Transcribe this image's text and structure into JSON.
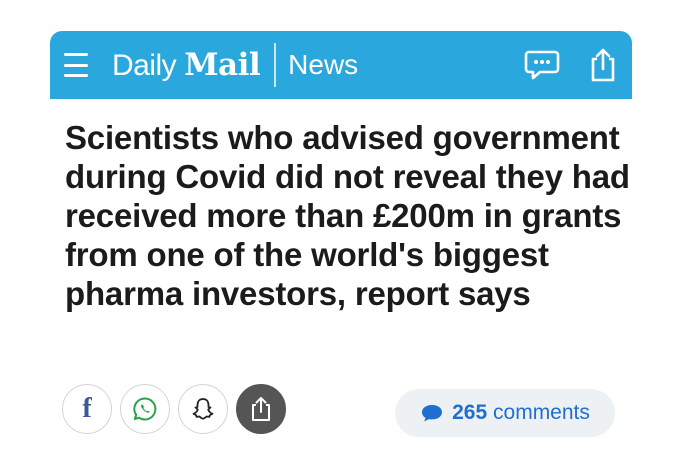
{
  "header": {
    "logo_daily": "Daily",
    "logo_mail": "Mail",
    "section": "News",
    "background_color": "#2aa7dc"
  },
  "article": {
    "headline": "Scientists who advised government during Covid did not reveal they had received more than £200m in grants from one of the world's biggest pharma investors, report says"
  },
  "share": {
    "buttons": [
      "facebook-icon",
      "whatsapp-icon",
      "snapchat-icon",
      "share-icon"
    ]
  },
  "comments": {
    "count": "265",
    "label": "comments",
    "color": "#1f6fd1"
  }
}
